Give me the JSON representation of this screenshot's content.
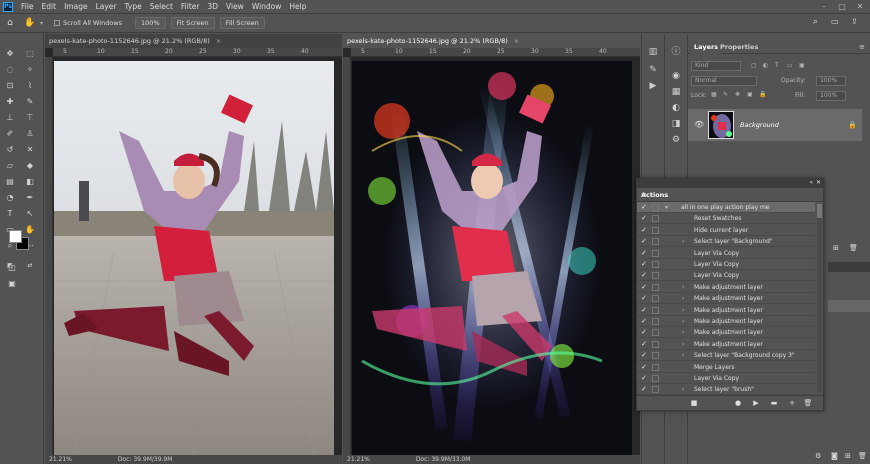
{
  "app": {
    "logo": "Ps",
    "menu": [
      "File",
      "Edit",
      "Image",
      "Layer",
      "Type",
      "Select",
      "Filter",
      "3D",
      "View",
      "Window",
      "Help"
    ],
    "window_controls": [
      "–",
      "□",
      "✕"
    ]
  },
  "options_bar": {
    "scroll_all_windows": "Scroll All Windows",
    "zoom_100": "100%",
    "fit_screen": "Fit Screen",
    "fill_screen": "Fill Screen"
  },
  "documents": [
    {
      "tab": "pexels-kate-photo-1152646.jpg @ 21.2% (RGB/8)",
      "close": "×",
      "zoom": "21.21%",
      "doc_info": "Doc: 39.9M/39.9M",
      "ruler": [
        "5",
        "10",
        "15",
        "20",
        "25",
        "30",
        "35",
        "40"
      ]
    },
    {
      "tab": "pexels-kate-photo-1152646.jpg @ 21.2% (RGB/8)",
      "close": "×",
      "zoom": "21.21%",
      "doc_info": "Doc: 39.9M/33.0M",
      "ruler": [
        "5",
        "10",
        "15",
        "20",
        "25",
        "30",
        "35",
        "40"
      ]
    }
  ],
  "layers_panel": {
    "tabs": [
      "Layers",
      "Properties"
    ],
    "search_placeholder": "Kind",
    "blend_mode": "Normal",
    "opacity_label": "Opacity:",
    "opacity_value": "100%",
    "lock_label": "Lock:",
    "fill_label": "Fill:",
    "fill_value": "100%",
    "layer_name": "Background"
  },
  "actions_panel": {
    "title": "Actions",
    "rows": [
      {
        "check": "✓",
        "label": "all in one play action play me",
        "set": true
      },
      {
        "check": "✓",
        "label": "Reset Swatches",
        "expand": ""
      },
      {
        "check": "✓",
        "label": "Hide current layer",
        "expand": ""
      },
      {
        "check": "✓",
        "label": "Select layer \"Background\"",
        "expand": "›"
      },
      {
        "check": "✓",
        "label": "Layer Via Copy",
        "expand": ""
      },
      {
        "check": "✓",
        "label": "Layer Via Copy",
        "expand": ""
      },
      {
        "check": "✓",
        "label": "Layer Via Copy",
        "expand": ""
      },
      {
        "check": "✓",
        "label": "Make adjustment layer",
        "expand": "›"
      },
      {
        "check": "✓",
        "label": "Make adjustment layer",
        "expand": "›"
      },
      {
        "check": "✓",
        "label": "Make adjustment layer",
        "expand": "›"
      },
      {
        "check": "✓",
        "label": "Make adjustment layer",
        "expand": "›"
      },
      {
        "check": "✓",
        "label": "Make adjustment layer",
        "expand": "›"
      },
      {
        "check": "✓",
        "label": "Make adjustment layer",
        "expand": "›"
      },
      {
        "check": "✓",
        "label": "Select layer \"Background copy 3\"",
        "expand": "›"
      },
      {
        "check": "✓",
        "label": "Merge Layers",
        "expand": ""
      },
      {
        "check": "✓",
        "label": "Layer Via Copy",
        "expand": ""
      },
      {
        "check": "✓",
        "label": "Select layer \"brush\"",
        "expand": "›"
      }
    ],
    "bottom_icons": [
      "■",
      "●",
      "▶",
      "▬",
      "+",
      "🗑"
    ]
  },
  "colors": {
    "foreground": "#ffffff",
    "background": "#000000",
    "accent": "#31a8ff"
  }
}
